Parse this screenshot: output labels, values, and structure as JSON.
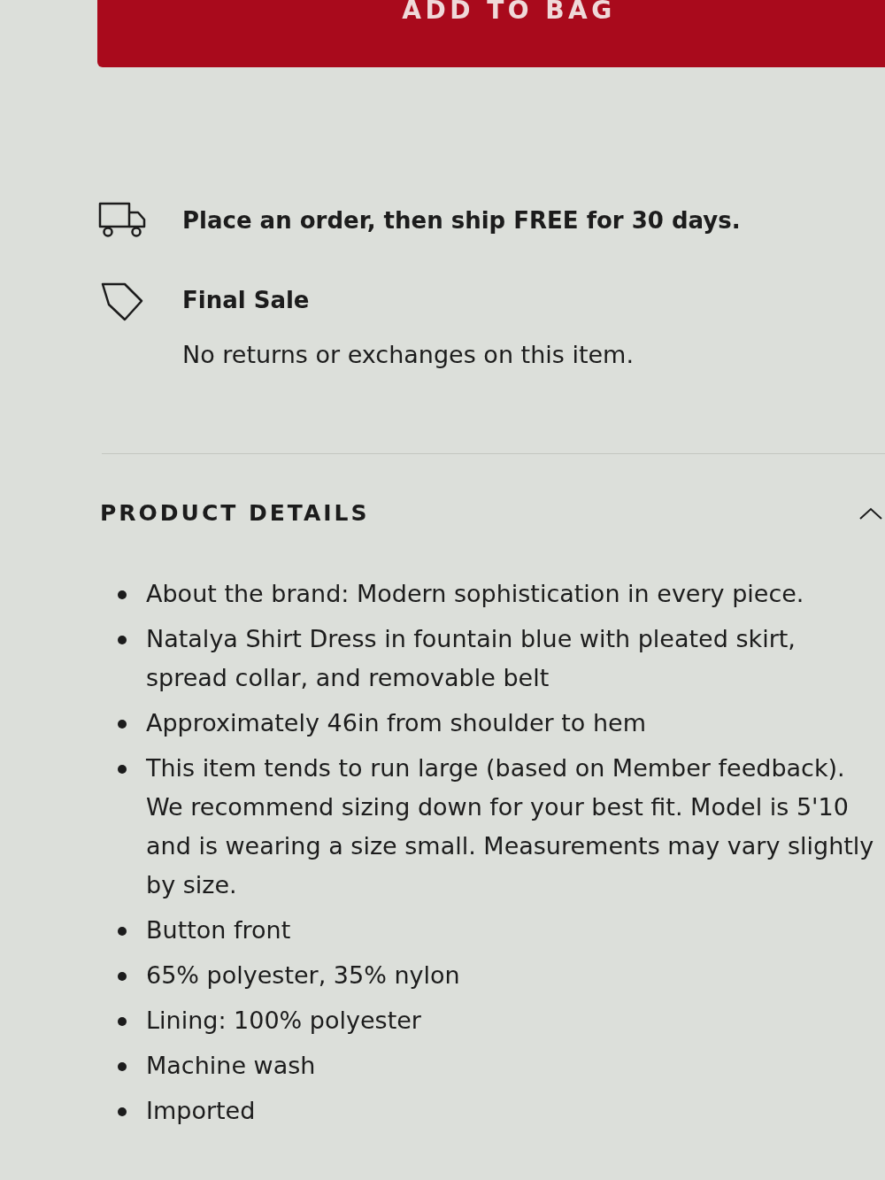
{
  "add_to_bag_button": {
    "label": "ADD TO BAG"
  },
  "perks": [
    {
      "kind": "shipping",
      "title": "Place an order, then ship FREE for 30 days."
    },
    {
      "kind": "final_sale",
      "title": "Final Sale",
      "description": "No returns or exchanges on this item."
    }
  ],
  "product_details": {
    "heading": "PRODUCT DETAILS",
    "expanded": true,
    "items": [
      "About the brand: Modern sophistication in every piece.",
      "Natalya Shirt Dress in fountain blue with pleated skirt, spread collar, and removable belt",
      "Approximately 46in from shoulder to hem",
      "This item tends to run large (based on Member feedback). We recommend sizing down for your best fit. Model is 5'10 and is wearing a size small. Measurements may vary slightly by size.",
      "Button front",
      "65% polyester, 35% nylon",
      "Lining: 100% polyester",
      "Machine wash",
      "Imported"
    ]
  }
}
